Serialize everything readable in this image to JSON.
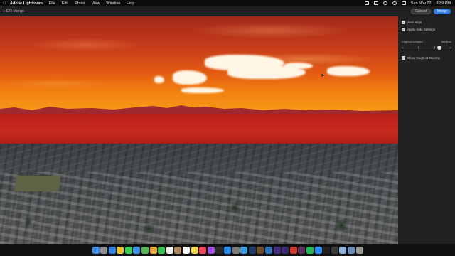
{
  "menubar": {
    "app_name": "Adobe Lightroom",
    "menus": [
      "File",
      "Edit",
      "Photo",
      "View",
      "Window",
      "Help"
    ],
    "status": {
      "date": "Sun Nov 22",
      "time": "8:59 PM"
    },
    "icons": [
      "apple-icon",
      "dropbox-icon",
      "battery-icon",
      "wifi-icon",
      "search-icon",
      "control-center-icon"
    ]
  },
  "header": {
    "title": "HDR Merge",
    "cancel_label": "Cancel",
    "merge_label": "Merge"
  },
  "panel": {
    "auto_align": {
      "label": "Auto Align",
      "checked": true
    },
    "apply_auto_settings": {
      "label": "Apply Auto Settings",
      "checked": true
    },
    "deghost": {
      "label": "Deghost Amount",
      "value_label": "Medium",
      "level": 0.75
    },
    "show_deghost_overlay": {
      "label": "Show Deghost Overlay",
      "checked": true
    }
  },
  "dock": {
    "apps": [
      {
        "name": "finder-icon",
        "color": "#3a8ee6"
      },
      {
        "name": "launchpad-icon",
        "color": "#8f8f8f"
      },
      {
        "name": "safari-icon",
        "color": "#2b7fe0"
      },
      {
        "name": "chrome-icon",
        "color": "#e7c03a"
      },
      {
        "name": "messages-icon",
        "color": "#3ecf5a"
      },
      {
        "name": "mail-icon",
        "color": "#3d8fe8"
      },
      {
        "name": "maps-icon",
        "color": "#56b85a"
      },
      {
        "name": "photos-icon",
        "color": "#e8a23a"
      },
      {
        "name": "facetime-icon",
        "color": "#39c153"
      },
      {
        "name": "calendar-icon",
        "color": "#f2f2f2"
      },
      {
        "name": "contacts-icon",
        "color": "#b08a5a"
      },
      {
        "name": "reminders-icon",
        "color": "#f5f5f5"
      },
      {
        "name": "notes-icon",
        "color": "#f3d84a"
      },
      {
        "name": "music-icon",
        "color": "#f0485a"
      },
      {
        "name": "podcasts-icon",
        "color": "#9b4de0"
      },
      {
        "name": "tv-icon",
        "color": "#2a2a2a"
      },
      {
        "name": "app-store-icon",
        "color": "#2a8cf0"
      },
      {
        "name": "system-preferences-icon",
        "color": "#7d7d7d"
      },
      {
        "name": "lightroom-icon",
        "color": "#3a9bd9"
      },
      {
        "name": "lightroom-classic-icon",
        "color": "#1d3f66"
      },
      {
        "name": "bridge-icon",
        "color": "#6f4a2a"
      },
      {
        "name": "photoshop-icon",
        "color": "#2c6fb8"
      },
      {
        "name": "premiere-icon",
        "color": "#4a2c7a"
      },
      {
        "name": "after-effects-icon",
        "color": "#3b2c6e"
      },
      {
        "name": "acrobat-icon",
        "color": "#c9372c"
      },
      {
        "name": "slack-icon",
        "color": "#5b2f5a"
      },
      {
        "name": "spotify-icon",
        "color": "#1db954"
      },
      {
        "name": "zoom-icon",
        "color": "#2d8cff"
      },
      {
        "name": "terminal-icon",
        "color": "#222"
      },
      {
        "name": "activity-monitor-icon",
        "color": "#3a3a3a"
      },
      {
        "name": "preview-icon",
        "color": "#8fb0d8"
      },
      {
        "name": "downloads-icon",
        "color": "#6a8ab8"
      },
      {
        "name": "trash-icon",
        "color": "#9a9a9a"
      }
    ]
  }
}
